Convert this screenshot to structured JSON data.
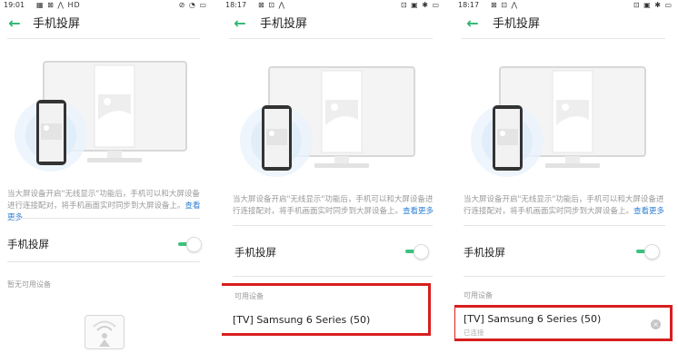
{
  "panels": [
    {
      "status": {
        "time": "19:01",
        "icons": "▦ ⊠ ⋀ HD",
        "right": "⊘ ◔ ▭"
      },
      "title": "手机投屏",
      "description": "当大屏设备开启\"无线显示\"功能后，手机可以和大屏设备进行连接配对，将手机画面实时同步到大屏设备上。",
      "more_link": "查看更多",
      "toggle_label": "手机投屏",
      "toggle_on": true,
      "section_label": "暂无可用设备"
    },
    {
      "status": {
        "time": "18:17",
        "icons": "⊠ ⊡ ⋀",
        "right": "⊡ ▣ ✱ ▭"
      },
      "title": "手机投屏",
      "description": "当大屏设备开启\"无线显示\"功能后，手机可以和大屏设备进行连接配对，将手机画面实时同步到大屏设备上。",
      "more_link": "查看更多",
      "toggle_label": "手机投屏",
      "toggle_on": true,
      "section_label": "可用设备",
      "device_name": "[TV] Samsung 6 Series (50)"
    },
    {
      "status": {
        "time": "18:17",
        "icons": "⊠ ⊡ ⋀",
        "right": "⊡ ▣ ✱ ▭"
      },
      "title": "手机投屏",
      "description": "当大屏设备开启\"无线显示\"功能后，手机可以和大屏设备进行连接配对，将手机画面实时同步到大屏设备上。",
      "more_link": "查看更多",
      "toggle_label": "手机投屏",
      "toggle_on": true,
      "section_label": "可用设备",
      "device_name": "[TV] Samsung 6 Series (50)",
      "device_status": "已连接"
    }
  ],
  "colors": {
    "accent": "#2bb673",
    "toggle": "#3cc27f",
    "link": "#2d7fd6",
    "highlight": "#d81e1e"
  },
  "icons": {
    "back": "arrow-left-icon",
    "clear": "close-circle-icon",
    "cast": "screen-cast-icon"
  }
}
